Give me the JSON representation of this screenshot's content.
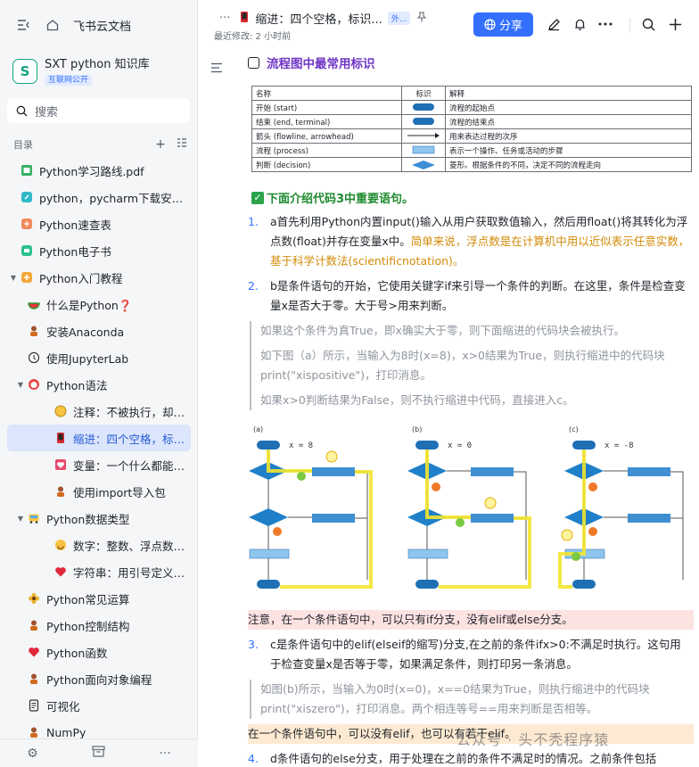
{
  "app": {
    "name": "飞书云文档"
  },
  "kb": {
    "badge": "S",
    "title": "SXT python 知识库",
    "tag": "互联网公开"
  },
  "search": {
    "label": "搜索"
  },
  "toc": {
    "label": "目录"
  },
  "tree": [
    {
      "label": "Python学习路线.pdf",
      "icon": "pdf-icon",
      "indent": 0,
      "arrow": ""
    },
    {
      "label": "python，pycharm下载安装教...",
      "icon": "link-icon",
      "indent": 0,
      "arrow": ""
    },
    {
      "label": "Python速查表",
      "icon": "sheet-icon",
      "indent": 0,
      "arrow": ""
    },
    {
      "label": "Python电子书",
      "icon": "tag-icon",
      "indent": 0,
      "arrow": ""
    },
    {
      "label": "Python入门教程",
      "icon": "folder-icon",
      "indent": 0,
      "arrow": "▼"
    },
    {
      "label": "什么是Python❓",
      "icon": "watermelon-icon",
      "indent": 1,
      "arrow": ""
    },
    {
      "label": "安装Anaconda",
      "icon": "person-icon",
      "indent": 1,
      "arrow": ""
    },
    {
      "label": "使用JupyterLab",
      "icon": "clock-icon",
      "indent": 1,
      "arrow": ""
    },
    {
      "label": "Python语法",
      "icon": "face-icon",
      "indent": 1,
      "arrow": "▼"
    },
    {
      "label": "注释：不被执行，却很...",
      "icon": "coin-icon",
      "indent": 2,
      "arrow": ""
    },
    {
      "label": "缩进：四个空格，标识...",
      "icon": "phone-icon",
      "indent": 2,
      "arrow": "",
      "selected": true
    },
    {
      "label": "变量：一个什么都能装...",
      "icon": "heart-box-icon",
      "indent": 2,
      "arrow": ""
    },
    {
      "label": "使用import导入包",
      "icon": "person-icon",
      "indent": 2,
      "arrow": ""
    },
    {
      "label": "Python数据类型",
      "icon": "bus-icon",
      "indent": 1,
      "arrow": "▼"
    },
    {
      "label": "数字：整数、浮点数、...",
      "icon": "smile-icon",
      "indent": 2,
      "arrow": ""
    },
    {
      "label": "字符串：用引号定义的...",
      "icon": "heart-icon",
      "indent": 2,
      "arrow": ""
    },
    {
      "label": "Python常见运算",
      "icon": "flower-icon",
      "indent": 1,
      "arrow": ""
    },
    {
      "label": "Python控制结构",
      "icon": "person-icon",
      "indent": 1,
      "arrow": ""
    },
    {
      "label": "Python函数",
      "icon": "heart-icon",
      "indent": 1,
      "arrow": ""
    },
    {
      "label": "Python面向对象编程",
      "icon": "person-icon",
      "indent": 1,
      "arrow": ""
    },
    {
      "label": "可视化",
      "icon": "doc-icon",
      "indent": 1,
      "arrow": ""
    },
    {
      "label": "NumPy",
      "icon": "person-icon",
      "indent": 1,
      "arrow": ""
    }
  ],
  "header": {
    "dots": "···",
    "title": "缩进：四个空格，标识...",
    "ext_tag": "外...",
    "subtitle": "最近修改: 2 小时前",
    "share": "分享"
  },
  "doc": {
    "section_title": "流程图中最常用标识",
    "table": {
      "headers": [
        "名称",
        "标识",
        "解释"
      ],
      "rows": [
        {
          "name": "开始 (start)",
          "shape": "terminal",
          "desc": "流程的起始点"
        },
        {
          "name": "结束 (end, terminal)",
          "shape": "terminal",
          "desc": "流程的结束点"
        },
        {
          "name": "箭头 (flowline, arrowhead)",
          "shape": "arrow",
          "desc": "用来表达过程的次序"
        },
        {
          "name": "流程 (process)",
          "shape": "process",
          "desc": "表示一个操作、任务或活动的步骤"
        },
        {
          "name": "判断 (decision)",
          "shape": "decision",
          "desc": "菱形。根据条件的不同，决定不同的流程走向"
        }
      ]
    },
    "green_heading": "下面介绍代码3中重要语句。",
    "p1_num": "1.",
    "p1_text": "a首先利用Python内置input()输入从用户获取数值输入，然后用float()将其转化为浮点数(float)并存在变量x中。",
    "p1_orange": "简单来说，浮点数是在计算机中用以近似表示任意实数，基于科学计数法(scientificnotation)。",
    "p2_num": "2.",
    "p2_text": "b是条件语句的开始，它使用关键字if来引导一个条件的判断。在这里，条件是检查变量x是否大于零。大于号>用来判断。",
    "q1": "如果这个条件为真True，即x确实大于零，则下面缩进的代码块会被执行。",
    "q2": "如下图（a）所示，当输入为8时(x=8)，x>0结果为True，则执行缩进中的代码块print(\"xispositive\")，打印消息。",
    "q3": "如果x>0判断结果为False，则不执行缩进中代码，直接进入c。",
    "fig": {
      "labels": [
        "(a)",
        "(b)",
        "(c)"
      ],
      "conds": [
        "x = 8",
        "x = 0",
        "x = -8"
      ]
    },
    "hl1": "注意，在一个条件语句中，可以只有if分支，没有elif或else分支。",
    "p3_num": "3.",
    "p3_text": "c是条件语句中的elif(elseif的缩写)分支,在之前的条件ifx>0:不满足时执行。这句用于检查变量x是否等于零，如果满足条件，则打印另一条消息。",
    "q4": "如图(b)所示，当输入为0时(x=0)，x==0结果为True，则执行缩进中的代码块print(\"xiszero\")，打印消息。两个相连等号==用来判断是否相等。",
    "hl2": "在一个条件语句中，可以没有elif，也可以有若干elif。",
    "p4_num": "4.",
    "p4_text": "d条件语句的else分支，用于处理在之前的条件不满足时的情况。之前条件包括",
    "watermark": "公众号 · 头不秃程序猿"
  },
  "colors": {
    "accent": "#3370ff",
    "selected_bg": "#dbe5fb",
    "section_purple": "#6f35c4",
    "flow_blue": "#1f6fb5"
  }
}
